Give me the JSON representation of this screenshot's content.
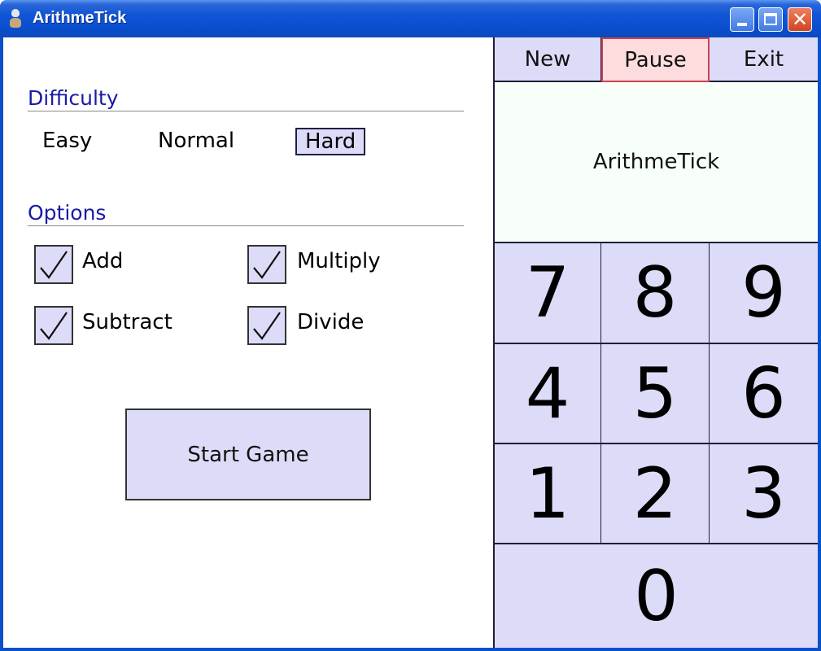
{
  "window": {
    "title": "ArithmeTick",
    "controls": {
      "minimize": "minimize",
      "maximize": "maximize",
      "close": "✕"
    }
  },
  "settings": {
    "difficulty": {
      "heading": "Difficulty",
      "options": [
        "Easy",
        "Normal",
        "Hard"
      ],
      "selected": "Hard"
    },
    "options": {
      "heading": "Options",
      "checkboxes": [
        {
          "label": "Add",
          "checked": true
        },
        {
          "label": "Multiply",
          "checked": true
        },
        {
          "label": "Subtract",
          "checked": true
        },
        {
          "label": "Divide",
          "checked": true
        }
      ]
    },
    "start_label": "Start Game"
  },
  "panel": {
    "buttons": {
      "new": "New",
      "pause": "Pause",
      "exit": "Exit"
    },
    "active_button": "Pause",
    "display_text": "ArithmeTick",
    "keypad": [
      "7",
      "8",
      "9",
      "4",
      "5",
      "6",
      "1",
      "2",
      "3",
      "0"
    ]
  },
  "colors": {
    "heading": "#1a1aa8",
    "button_fill": "#dcdcf8",
    "active_button_fill": "#fcdcdc",
    "active_button_border": "#d04050",
    "display_fill": "#f8fff8"
  }
}
